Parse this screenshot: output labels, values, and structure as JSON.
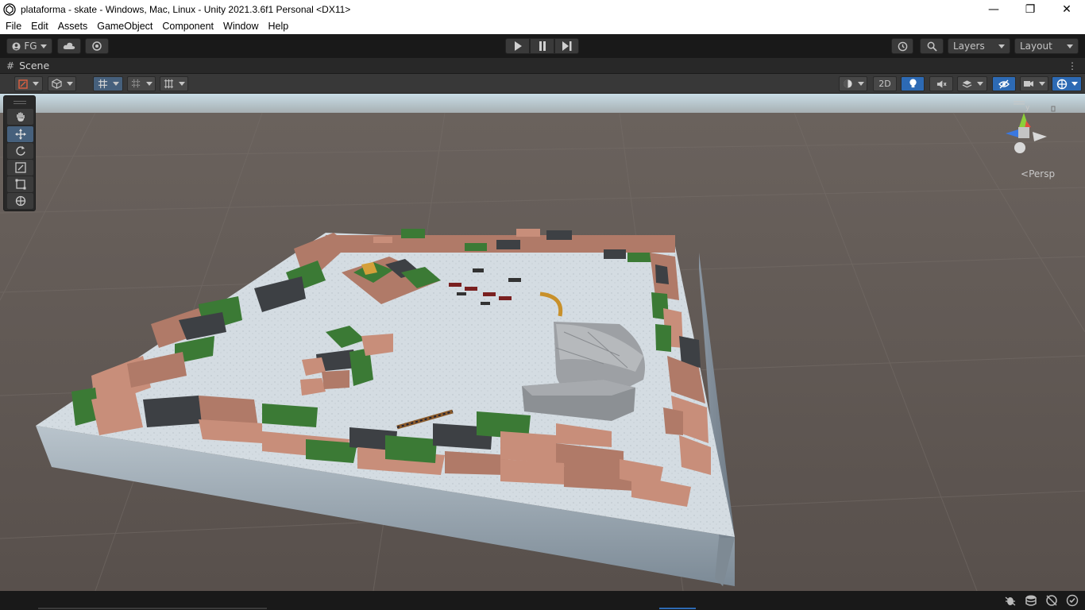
{
  "window": {
    "title": "plataforma - skate - Windows, Mac, Linux - Unity 2021.3.6f1 Personal <DX11>",
    "minimize": "—",
    "maximize": "❐",
    "close": "✕"
  },
  "menu": [
    "File",
    "Edit",
    "Assets",
    "GameObject",
    "Component",
    "Window",
    "Help"
  ],
  "toolbar": {
    "account": "FG",
    "layers": "Layers",
    "layout": "Layout"
  },
  "scene_tab": {
    "label": "Scene"
  },
  "scene_toolbar": {
    "mode_2d": "2D"
  },
  "view": {
    "projection": "Persp",
    "axis_y": "y",
    "axis_z": "z"
  },
  "colors": {
    "accent": "#2d6ab4",
    "sky": "#bcd2dc",
    "ground": "#5c5450"
  }
}
